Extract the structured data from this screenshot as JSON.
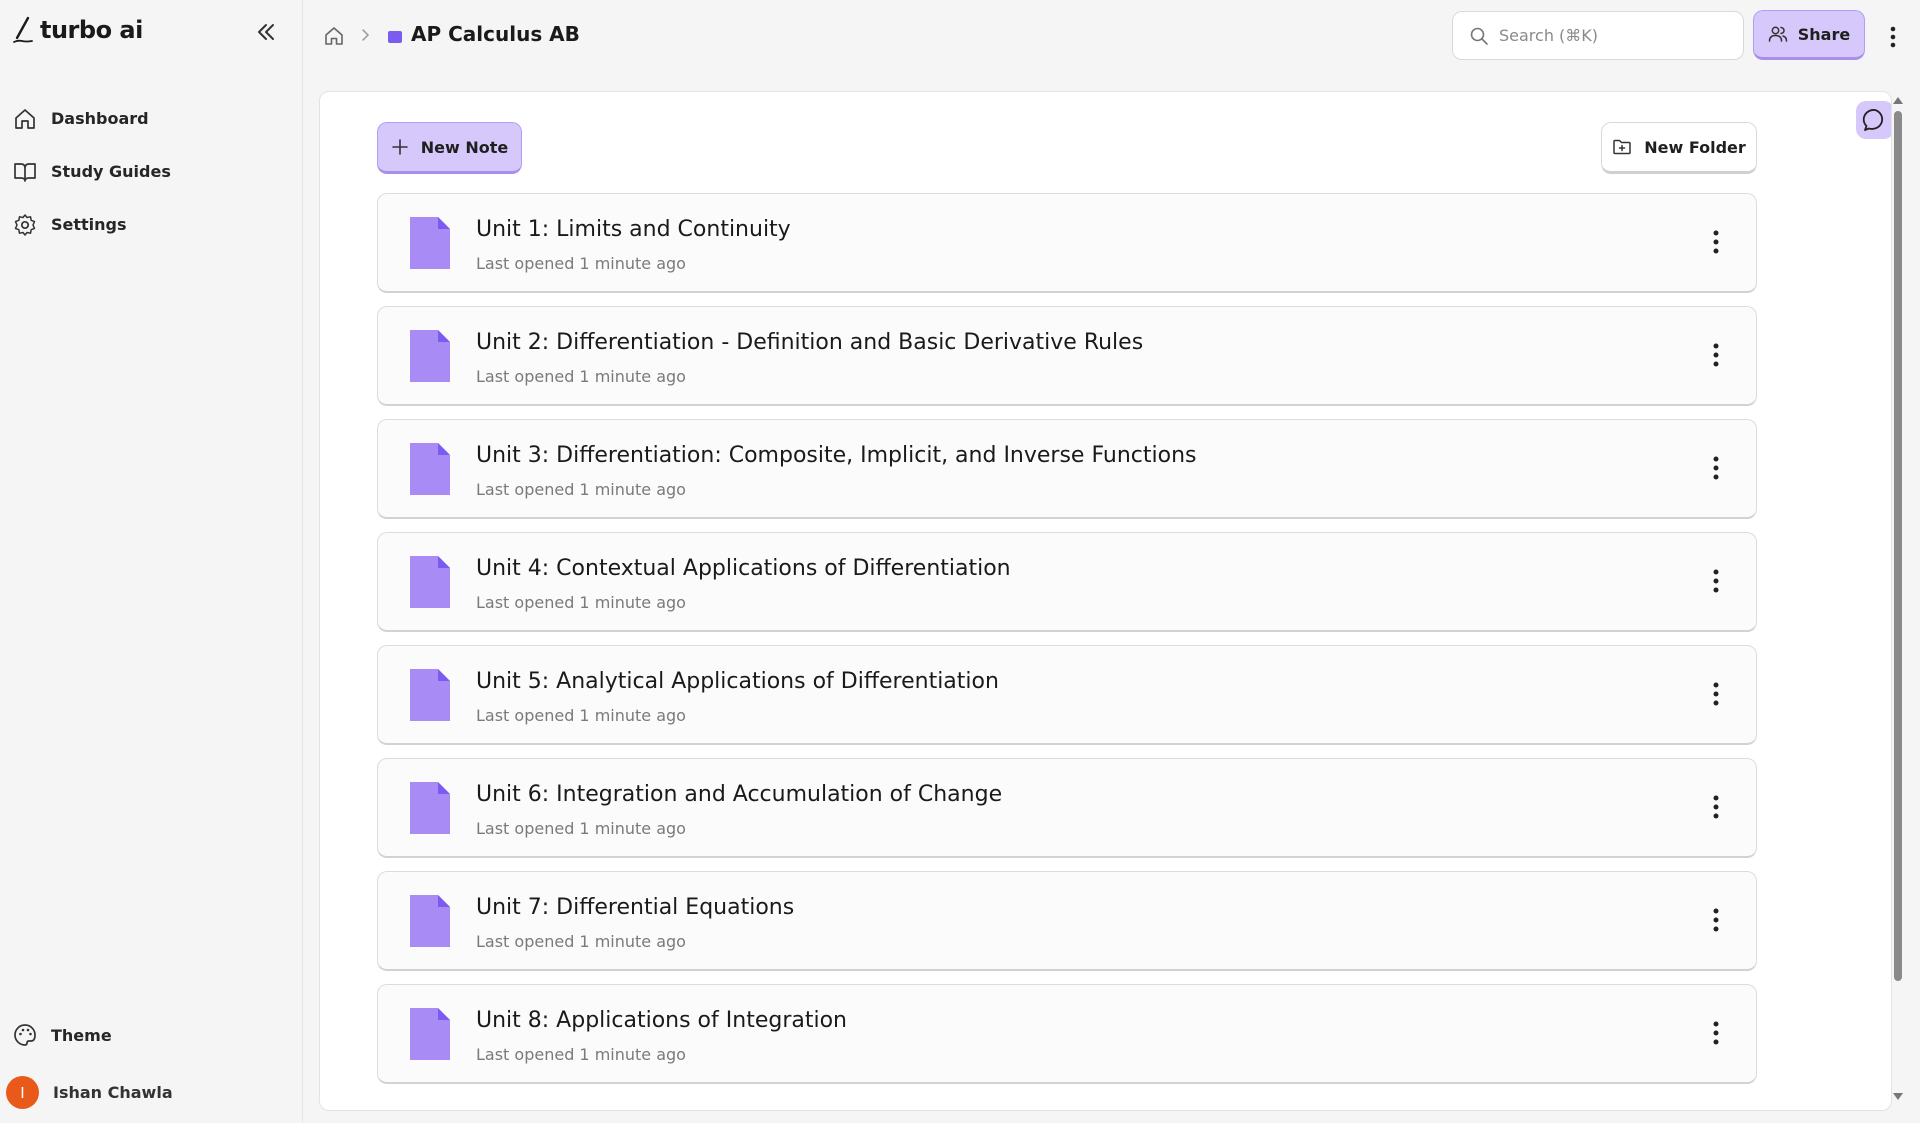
{
  "app": {
    "name": "turbo ai"
  },
  "sidebar": {
    "items": [
      {
        "label": "Dashboard",
        "icon": "home-icon"
      },
      {
        "label": "Study Guides",
        "icon": "book-icon"
      },
      {
        "label": "Settings",
        "icon": "gear-icon"
      }
    ],
    "theme_label": "Theme",
    "user": {
      "initial": "I",
      "name": "Ishan Chawla"
    }
  },
  "header": {
    "breadcrumb_title": "AP Calculus AB",
    "folder_color": "#7c5cf0",
    "search_placeholder": "Search (⌘K)",
    "share_label": "Share"
  },
  "toolbar": {
    "new_note_label": "New Note",
    "new_folder_label": "New Folder"
  },
  "notes": [
    {
      "title": "Unit 1: Limits and Continuity",
      "meta": "Last opened 1 minute ago"
    },
    {
      "title": "Unit 2: Differentiation - Definition and Basic Derivative Rules",
      "meta": "Last opened 1 minute ago"
    },
    {
      "title": "Unit 3: Differentiation: Composite, Implicit, and Inverse Functions",
      "meta": "Last opened 1 minute ago"
    },
    {
      "title": "Unit 4: Contextual Applications of Differentiation",
      "meta": "Last opened 1 minute ago"
    },
    {
      "title": "Unit 5: Analytical Applications of Differentiation",
      "meta": "Last opened 1 minute ago"
    },
    {
      "title": "Unit 6: Integration and Accumulation of Change",
      "meta": "Last opened 1 minute ago"
    },
    {
      "title": "Unit 7: Differential Equations",
      "meta": "Last opened 1 minute ago"
    },
    {
      "title": "Unit 8: Applications of Integration",
      "meta": "Last opened 1 minute ago"
    }
  ],
  "colors": {
    "accent": "#d7c8fb",
    "file_icon": "#a98bf5",
    "avatar": "#e8591a"
  }
}
